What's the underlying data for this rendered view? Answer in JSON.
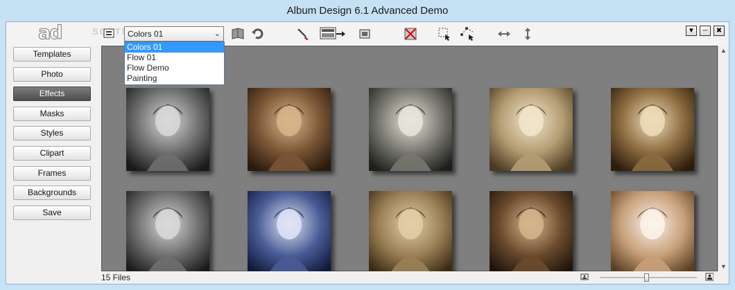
{
  "window": {
    "title": "Album Design 6.1 Advanced Demo"
  },
  "toolbar": {
    "logo_text": "ad",
    "watermark": "SOFTPEDIA",
    "preset_select": {
      "value": "Colors 01",
      "options": [
        "Colors 01",
        "Flow 01",
        "Flow Demo",
        "Painting"
      ]
    },
    "icons": [
      "layout-icon",
      "book-icon",
      "undo-icon",
      "brush-icon",
      "apply-effect-icon",
      "small-image-icon",
      "delete-icon",
      "select-icon",
      "rotate-select-icon",
      "flip-horizontal-icon",
      "flip-vertical-icon"
    ]
  },
  "sidebar": {
    "items": [
      {
        "label": "Templates",
        "active": false
      },
      {
        "label": "Photo",
        "active": false
      },
      {
        "label": "Effects",
        "active": true
      },
      {
        "label": "Masks",
        "active": false
      },
      {
        "label": "Styles",
        "active": false
      },
      {
        "label": "Clipart",
        "active": false
      },
      {
        "label": "Frames",
        "active": false
      },
      {
        "label": "Backgrounds",
        "active": false
      },
      {
        "label": "Save",
        "active": false
      }
    ]
  },
  "gallery": {
    "thumbnails": [
      {
        "tone": "bw"
      },
      {
        "tone": "sepia-dark"
      },
      {
        "tone": "bw-warm"
      },
      {
        "tone": "cream"
      },
      {
        "tone": "sepia"
      },
      {
        "tone": "bw"
      },
      {
        "tone": "blue"
      },
      {
        "tone": "sepia-soft"
      },
      {
        "tone": "brown"
      },
      {
        "tone": "sepia-light"
      }
    ]
  },
  "status": {
    "file_count": "15 Files"
  },
  "colors": {
    "titlebar": "#c6e0f4",
    "gallery_bg": "#7f7f7f",
    "active_tab": "#5a5a5a",
    "selection": "#3399ff"
  }
}
